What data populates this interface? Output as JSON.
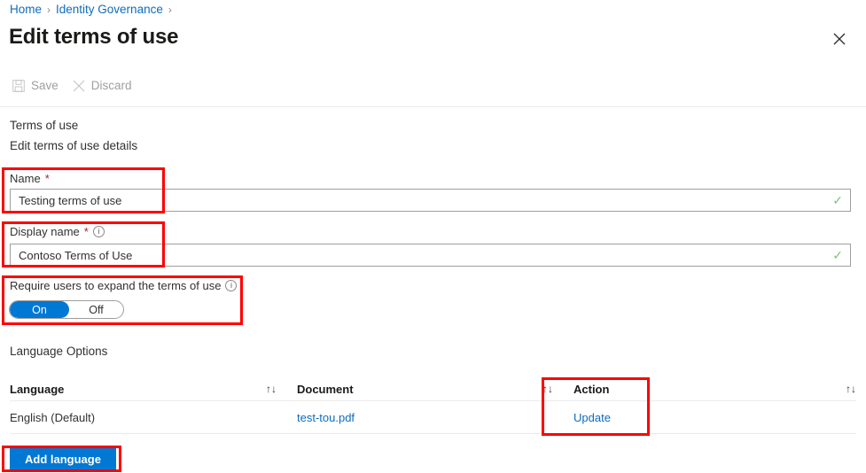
{
  "breadcrumb": {
    "items": [
      {
        "label": "Home"
      },
      {
        "label": "Identity Governance"
      }
    ],
    "separator": "›"
  },
  "header": {
    "title": "Edit terms of use",
    "close_label": "✕"
  },
  "toolbar": {
    "save_label": "Save",
    "discard_label": "Discard"
  },
  "section": {
    "title": "Terms of use",
    "subtitle": "Edit terms of use details"
  },
  "form": {
    "name": {
      "label": "Name",
      "required_marker": "*",
      "value": "Testing terms of use",
      "valid_marker": "✓"
    },
    "display_name": {
      "label": "Display name",
      "required_marker": "*",
      "info_glyph": "i",
      "value": "Contoso Terms of Use",
      "valid_marker": "✓"
    },
    "require_expand": {
      "label": "Require users to expand the terms of use",
      "info_glyph": "i",
      "on_label": "On",
      "off_label": "Off",
      "selected": "On"
    }
  },
  "language_options": {
    "title": "Language Options",
    "columns": [
      {
        "label": "Language",
        "sort_glyph": "↑↓"
      },
      {
        "label": "Document",
        "sort_glyph": "↑↓"
      },
      {
        "label": "Action",
        "sort_glyph": "↑↓"
      }
    ],
    "rows": [
      {
        "language": "English (Default)",
        "document": "test-tou.pdf",
        "action": "Update"
      }
    ],
    "add_button_label": "Add language"
  },
  "colors": {
    "accent": "#0078d4",
    "link": "#0f6cbd",
    "highlight": "#ff0000",
    "required": "#a4262c",
    "valid": "#7cc576"
  }
}
